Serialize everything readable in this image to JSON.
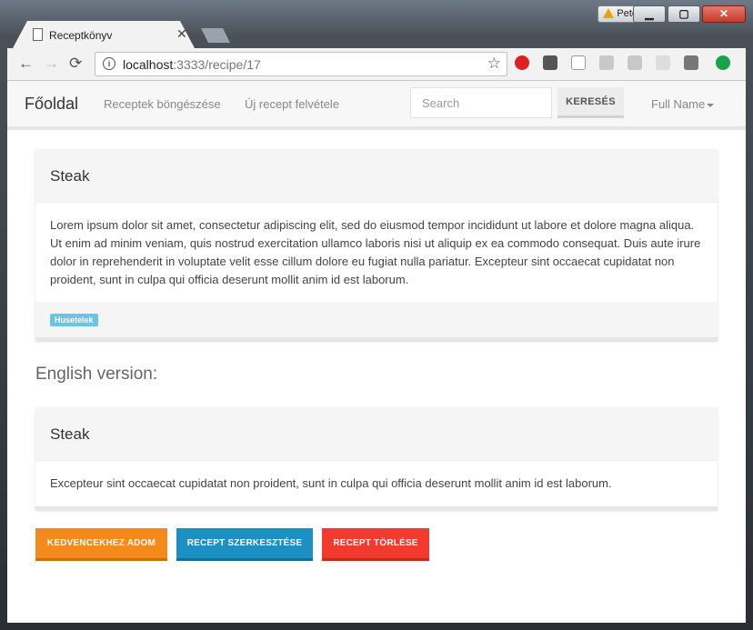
{
  "window": {
    "profile_name": "Pete",
    "minimize_glyph": "▁",
    "maximize_glyph": "▢",
    "close_glyph": "✕"
  },
  "tab": {
    "title": "Receptkönyv",
    "close_glyph": "✕"
  },
  "toolbar": {
    "back_glyph": "←",
    "forward_glyph": "→",
    "reload_glyph": "⟳",
    "url_host": "localhost",
    "url_path": ":3333/recipe/17",
    "info_glyph": "i",
    "star_glyph": "☆"
  },
  "navbar": {
    "brand": "Főoldal",
    "links": [
      "Receptek böngészése",
      "Új recept felvétele"
    ],
    "search_placeholder": "Search",
    "search_button": "KERESÉS",
    "user": "Full Name"
  },
  "recipe": {
    "title": "Steak",
    "description": "Lorem ipsum dolor sit amet, consectetur adipiscing elit, sed do eiusmod tempor incididunt ut labore et dolore magna aliqua. Ut enim ad minim veniam, quis nostrud exercitation ullamco laboris nisi ut aliquip ex ea commodo consequat. Duis aute irure dolor in reprehenderit in voluptate velit esse cillum dolore eu fugiat nulla pariatur. Excepteur sint occaecat cupidatat non proident, sunt in culpa qui officia deserunt mollit anim id est laborum.",
    "tag": "Husetelek"
  },
  "english": {
    "heading": "English version:",
    "title": "Steak",
    "description": "Excepteur sint occaecat cupidatat non proident, sunt in culpa qui officia deserunt mollit anim id est laborum."
  },
  "actions": {
    "favorite": "KEDVENCEKHEZ ADOM",
    "edit": "RECEPT SZERKESZTÉSE",
    "delete": "RECEPT TÖRLÉSE"
  },
  "colors": {
    "favorite": "#f58a1c",
    "edit": "#1c90c2",
    "delete": "#f23b2e",
    "tag": "#6cc3e3"
  },
  "icons": [
    "page-icon",
    "info-icon",
    "star-icon",
    "opera-icon",
    "pocket-icon",
    "translate-icon",
    "gmail-icon",
    "nx-icon",
    "hand-icon",
    "r-icon",
    "upload-icon"
  ]
}
